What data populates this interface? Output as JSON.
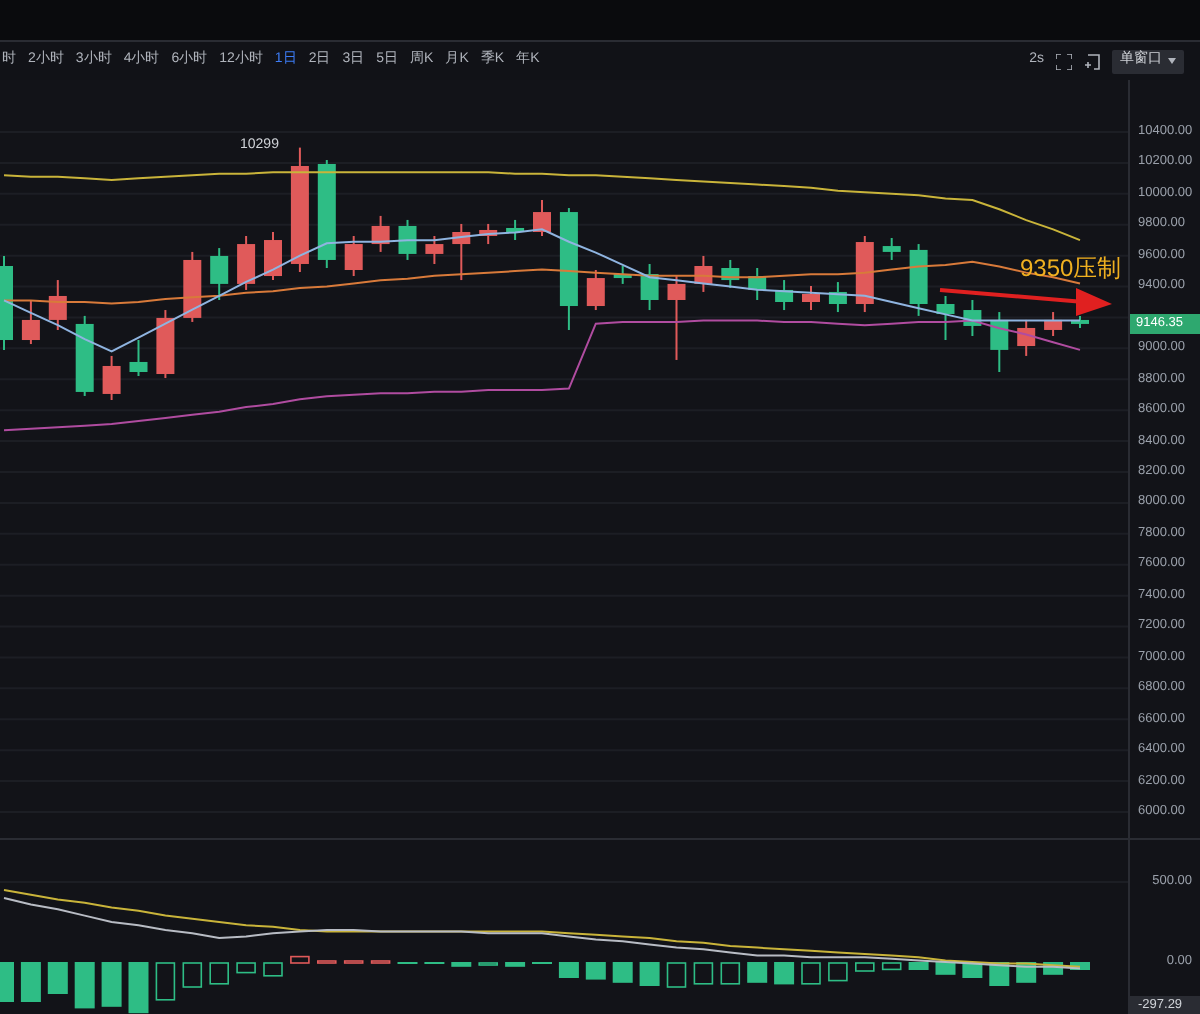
{
  "toolbar": {
    "intervals": [
      {
        "label": "时",
        "selected": false
      },
      {
        "label": "2小时",
        "selected": false
      },
      {
        "label": "3小时",
        "selected": false
      },
      {
        "label": "4小时",
        "selected": false
      },
      {
        "label": "6小时",
        "selected": false
      },
      {
        "label": "12小时",
        "selected": false
      },
      {
        "label": "1日",
        "selected": true
      },
      {
        "label": "2日",
        "selected": false
      },
      {
        "label": "3日",
        "selected": false
      },
      {
        "label": "5日",
        "selected": false
      },
      {
        "label": "周K",
        "selected": false
      },
      {
        "label": "月K",
        "selected": false
      },
      {
        "label": "季K",
        "selected": false
      },
      {
        "label": "年K",
        "selected": false
      }
    ],
    "refresh": "2s",
    "window_mode": "单窗口"
  },
  "price_chart": {
    "high_label": "10299",
    "annotation": "9350压制",
    "last_price": "9146.35",
    "chart_data": {
      "type": "candlestick",
      "ylim": [
        6000,
        10400
      ],
      "grid": true,
      "yticks": [
        {
          "value": 10400,
          "label": "10400.00"
        },
        {
          "value": 10200,
          "label": "10200.00"
        },
        {
          "value": 10000,
          "label": "10000.00"
        },
        {
          "value": 9800,
          "label": "9800.00"
        },
        {
          "value": 9600,
          "label": "9600.00"
        },
        {
          "value": 9400,
          "label": "9400.00"
        },
        {
          "value": 9000,
          "label": "9000.00"
        },
        {
          "value": 8800,
          "label": "8800.00"
        },
        {
          "value": 8600,
          "label": "8600.00"
        },
        {
          "value": 8400,
          "label": "8400.00"
        },
        {
          "value": 8200,
          "label": "8200.00"
        },
        {
          "value": 8000,
          "label": "8000.00"
        },
        {
          "value": 7800,
          "label": "7800.00"
        },
        {
          "value": 7600,
          "label": "7600.00"
        },
        {
          "value": 7400,
          "label": "7400.00"
        },
        {
          "value": 7200,
          "label": "7200.00"
        },
        {
          "value": 7000,
          "label": "7000.00"
        },
        {
          "value": 6800,
          "label": "6800.00"
        },
        {
          "value": 6600,
          "label": "6600.00"
        },
        {
          "value": 6400,
          "label": "6400.00"
        },
        {
          "value": 6200,
          "label": "6200.00"
        },
        {
          "value": 6000,
          "label": "6000.00"
        }
      ],
      "categories": [
        null,
        null,
        null,
        null,
        null,
        null,
        null,
        null,
        null,
        null,
        null,
        null,
        null,
        null,
        null,
        null,
        null,
        null,
        null,
        null,
        null,
        null,
        null,
        null,
        null,
        null,
        null,
        null,
        null,
        null,
        null,
        null,
        null,
        null,
        null,
        null,
        null,
        null,
        null,
        null,
        null
      ],
      "ohlc": [
        [
          9054,
          9598,
          8990,
          9533
        ],
        [
          9184,
          9313,
          9028,
          9054
        ],
        [
          9339,
          9442,
          9119,
          9184
        ],
        [
          8718,
          9210,
          8692,
          9158
        ],
        [
          8886,
          8951,
          8666,
          8705
        ],
        [
          8847,
          9054,
          8821,
          8912
        ],
        [
          9197,
          9248,
          8808,
          8834
        ],
        [
          9572,
          9624,
          9171,
          9197
        ],
        [
          9417,
          9649,
          9313,
          9598
        ],
        [
          9675,
          9727,
          9378,
          9417
        ],
        [
          9701,
          9753,
          9442,
          9468
        ],
        [
          10180,
          10299,
          9494,
          9546
        ],
        [
          9572,
          10219,
          9520,
          10193
        ],
        [
          9675,
          9727,
          9468,
          9507
        ],
        [
          9792,
          9857,
          9624,
          9675
        ],
        [
          9611,
          9831,
          9572,
          9792
        ],
        [
          9675,
          9727,
          9546,
          9611
        ],
        [
          9753,
          9805,
          9442,
          9675
        ],
        [
          9766,
          9805,
          9675,
          9727
        ],
        [
          9753,
          9831,
          9701,
          9779
        ],
        [
          9882,
          9960,
          9727,
          9753
        ],
        [
          9274,
          9908,
          9119,
          9882
        ],
        [
          9455,
          9507,
          9248,
          9274
        ],
        [
          9455,
          9533,
          9417,
          9481
        ],
        [
          9313,
          9546,
          9248,
          9481
        ],
        [
          9417,
          9468,
          8925,
          9313
        ],
        [
          9533,
          9598,
          9365,
          9417
        ],
        [
          9442,
          9572,
          9391,
          9520
        ],
        [
          9378,
          9520,
          9313,
          9468
        ],
        [
          9300,
          9442,
          9248,
          9378
        ],
        [
          9352,
          9404,
          9248,
          9300
        ],
        [
          9287,
          9429,
          9235,
          9365
        ],
        [
          9688,
          9727,
          9235,
          9287
        ],
        [
          9624,
          9714,
          9572,
          9662
        ],
        [
          9287,
          9675,
          9210,
          9637
        ],
        [
          9222,
          9339,
          9054,
          9287
        ],
        [
          9145,
          9313,
          9080,
          9248
        ],
        [
          8990,
          9235,
          8847,
          9184
        ],
        [
          9132,
          9184,
          8951,
          9015
        ],
        [
          9184,
          9235,
          9080,
          9119
        ],
        [
          9158,
          9210,
          9132,
          9184
        ]
      ],
      "series": [
        {
          "type": "line",
          "color": "#c9b43a",
          "values": [
            10120,
            10110,
            10110,
            10100,
            10090,
            10100,
            10110,
            10120,
            10130,
            10130,
            10140,
            10140,
            10140,
            10140,
            10140,
            10140,
            10140,
            10140,
            10140,
            10130,
            10130,
            10120,
            10120,
            10110,
            10100,
            10090,
            10080,
            10070,
            10060,
            10050,
            10040,
            10020,
            10010,
            10000,
            9990,
            9970,
            9960,
            9900,
            9830,
            9770,
            9700
          ]
        },
        {
          "type": "line",
          "color": "#d87a3a",
          "values": [
            9310,
            9310,
            9300,
            9300,
            9290,
            9300,
            9320,
            9330,
            9340,
            9360,
            9370,
            9390,
            9400,
            9420,
            9440,
            9450,
            9470,
            9480,
            9490,
            9500,
            9510,
            9500,
            9490,
            9480,
            9470,
            9470,
            9470,
            9460,
            9460,
            9470,
            9480,
            9480,
            9490,
            9510,
            9530,
            9540,
            9560,
            9530,
            9490,
            9460,
            9420
          ]
        },
        {
          "type": "line",
          "color": "#b04ca0",
          "values": [
            8470,
            8480,
            8490,
            8500,
            8510,
            8530,
            8550,
            8570,
            8590,
            8620,
            8640,
            8670,
            8690,
            8700,
            8710,
            8710,
            8720,
            8720,
            8730,
            8730,
            8730,
            8740,
            9160,
            9170,
            9170,
            9170,
            9180,
            9180,
            9180,
            9170,
            9170,
            9160,
            9150,
            9160,
            9170,
            9170,
            9180,
            9130,
            9090,
            9040,
            8990
          ]
        },
        {
          "type": "line",
          "color": "#8fb4e0",
          "values": [
            9310,
            9230,
            9150,
            9060,
            8980,
            9070,
            9160,
            9250,
            9340,
            9430,
            9510,
            9600,
            9680,
            9690,
            9690,
            9700,
            9700,
            9720,
            9740,
            9750,
            9770,
            9690,
            9620,
            9540,
            9460,
            9440,
            9420,
            9400,
            9380,
            9370,
            9360,
            9350,
            9340,
            9300,
            9260,
            9220,
            9180,
            9180,
            9180,
            9180,
            9180
          ]
        }
      ]
    }
  },
  "indicator": {
    "last_value": "-297.29",
    "chart_data": {
      "type": "bar",
      "ylim": [
        -325,
        762.5
      ],
      "grid": true,
      "yticks": [
        {
          "value": 500,
          "label": "500.00"
        },
        {
          "value": 0,
          "label": "0.00"
        }
      ],
      "categories": [
        null,
        null,
        null,
        null,
        null,
        null,
        null,
        null,
        null,
        null,
        null,
        null,
        null,
        null,
        null,
        null,
        null,
        null,
        null,
        null,
        null,
        null,
        null,
        null,
        null,
        null,
        null,
        null,
        null,
        null,
        null,
        null,
        null,
        null,
        null,
        null,
        null,
        null,
        null,
        null,
        null
      ],
      "series": [
        {
          "type": "bar",
          "color": "#2ebd85",
          "values": [
            -250,
            -250,
            -200,
            -290,
            -280,
            -320,
            null,
            null,
            null,
            null,
            null,
            null,
            null,
            null,
            null,
            -10,
            -10,
            -30,
            null,
            -30,
            -10,
            -100,
            -110,
            -130,
            -150,
            null,
            null,
            null,
            -130,
            -140,
            null,
            null,
            null,
            null,
            -50,
            -80,
            -100,
            -150,
            -130,
            -80,
            -50
          ]
        },
        {
          "type": "bar",
          "color": "#2ebd85",
          "values": [
            null,
            null,
            null,
            null,
            null,
            null,
            -230,
            -150,
            -130,
            -60,
            -80,
            null,
            null,
            null,
            null,
            null,
            null,
            null,
            -10,
            null,
            null,
            null,
            null,
            null,
            null,
            -150,
            -130,
            -130,
            null,
            null,
            -130,
            -110,
            -50,
            -40,
            null,
            null,
            null,
            null,
            null,
            null,
            null
          ]
        },
        {
          "type": "bar",
          "color": "#e05a5a",
          "values": [
            null,
            null,
            null,
            null,
            null,
            null,
            null,
            null,
            null,
            null,
            null,
            40,
            10,
            10,
            10,
            null,
            null,
            null,
            null,
            null,
            null,
            null,
            null,
            null,
            null,
            null,
            null,
            null,
            null,
            null,
            null,
            null,
            null,
            null,
            null,
            null,
            null,
            null,
            null,
            null,
            null
          ]
        },
        {
          "type": "line",
          "color": "#c9b43a",
          "values": [
            450,
            420,
            390,
            370,
            340,
            320,
            290,
            270,
            250,
            230,
            220,
            200,
            190,
            190,
            190,
            190,
            190,
            190,
            190,
            190,
            190,
            180,
            170,
            160,
            150,
            130,
            120,
            100,
            90,
            80,
            70,
            60,
            50,
            40,
            30,
            10,
            0,
            -10,
            -10,
            -20,
            -30
          ]
        },
        {
          "type": "line",
          "color": "#b8bcc4",
          "values": [
            400,
            360,
            330,
            290,
            250,
            230,
            200,
            180,
            150,
            160,
            180,
            190,
            200,
            200,
            190,
            190,
            190,
            190,
            180,
            180,
            180,
            160,
            140,
            130,
            110,
            90,
            80,
            60,
            40,
            40,
            30,
            30,
            30,
            20,
            10,
            0,
            -10,
            -20,
            -30,
            -30,
            -40
          ]
        }
      ]
    }
  }
}
